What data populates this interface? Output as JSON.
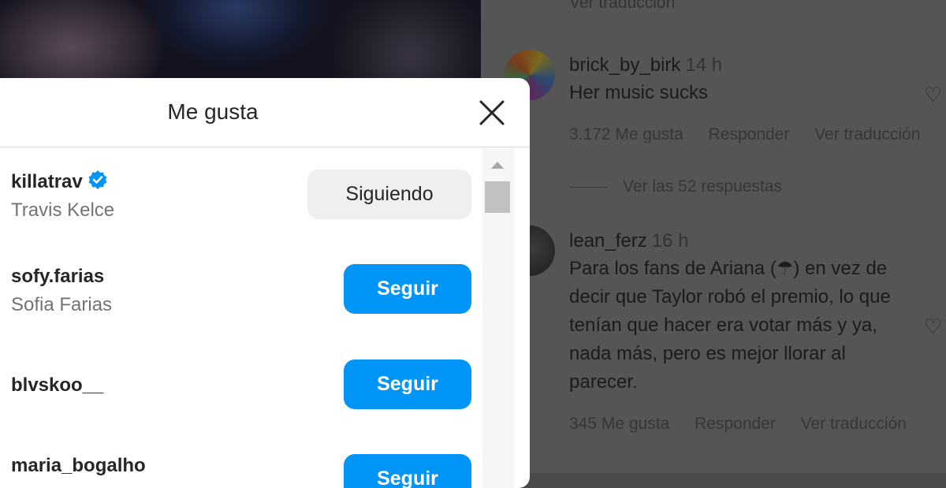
{
  "modal": {
    "title": "Me gusta",
    "users": [
      {
        "handle": "killatrav",
        "name": "Travis Kelce",
        "verified": true,
        "button": "Siguiendo"
      },
      {
        "handle": "sofy.farias",
        "name": "Sofia Farias",
        "verified": false,
        "button": "Seguir"
      },
      {
        "handle": "blvskoo__",
        "name": "",
        "verified": false,
        "button": "Seguir"
      },
      {
        "handle": "maria_bogalho",
        "name": "",
        "verified": false,
        "button": "Seguir"
      }
    ]
  },
  "comments": {
    "top_link": "Ver traducción",
    "items": [
      {
        "user": "brick_by_birk",
        "time": "14 h",
        "text": "Her music sucks",
        "likes": "3.172 Me gusta",
        "reply": "Responder",
        "translate": "Ver traducción"
      },
      {
        "user": "lean_ferz",
        "time": "16 h",
        "text": "Para los fans de Ariana (☂) en vez de decir que Taylor robó el premio, lo que tenían que hacer era votar más y ya, nada más, pero es mejor llorar al parecer.",
        "likes": "345 Me gusta",
        "reply": "Responder",
        "translate": "Ver traducción"
      }
    ],
    "view_replies": "Ver las 52 respuestas"
  },
  "colors": {
    "follow_blue": "#0095f6",
    "following_gray": "#efefef",
    "verified_blue": "#0095f6"
  }
}
